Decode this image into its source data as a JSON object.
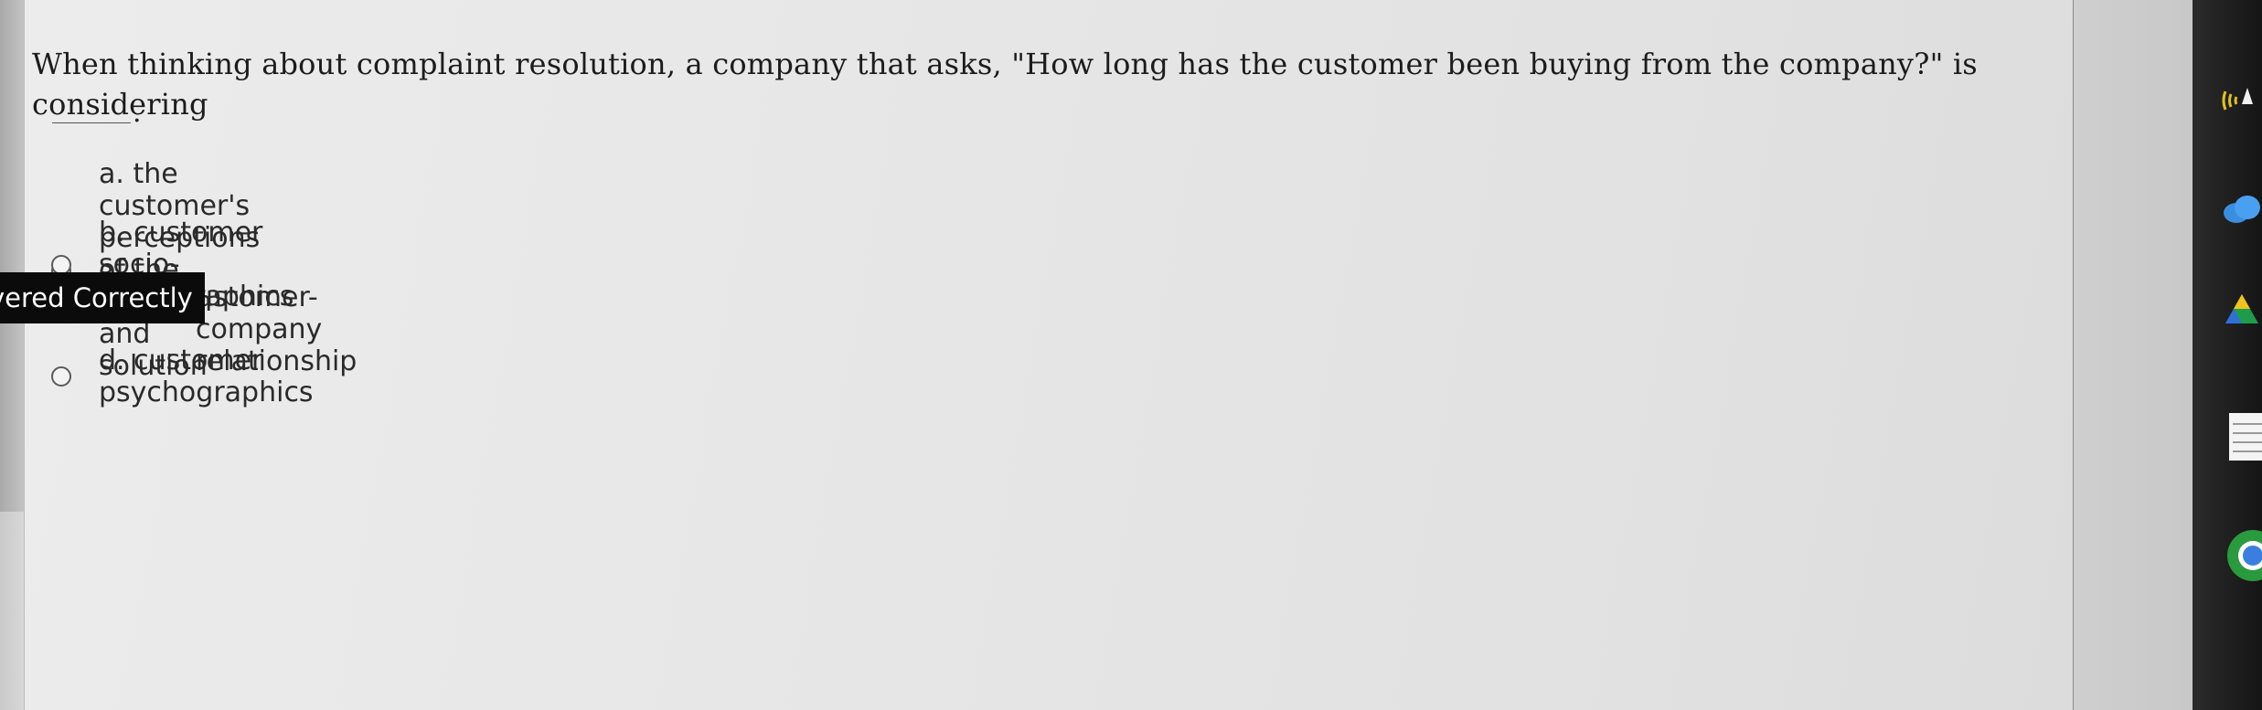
{
  "question": {
    "text": "When thinking about complaint resolution, a company that asks, \"How long has the customer been buying from the company?\" is considering",
    "blank_suffix": "."
  },
  "options": [
    {
      "label": "a. the customer's perceptions of the problem and solution",
      "selected": false
    },
    {
      "label": "b. customer socio-demographics",
      "selected": false
    },
    {
      "label": "ustomer-company relationship",
      "selected": true
    },
    {
      "label": "d. customer psychographics",
      "selected": false
    }
  ],
  "badge": {
    "text": "vered Correctly"
  },
  "dock": {
    "icons": [
      "wifi-icon",
      "cloud-icon",
      "drive-icon",
      "notes-icon",
      "chrome-icon"
    ]
  }
}
